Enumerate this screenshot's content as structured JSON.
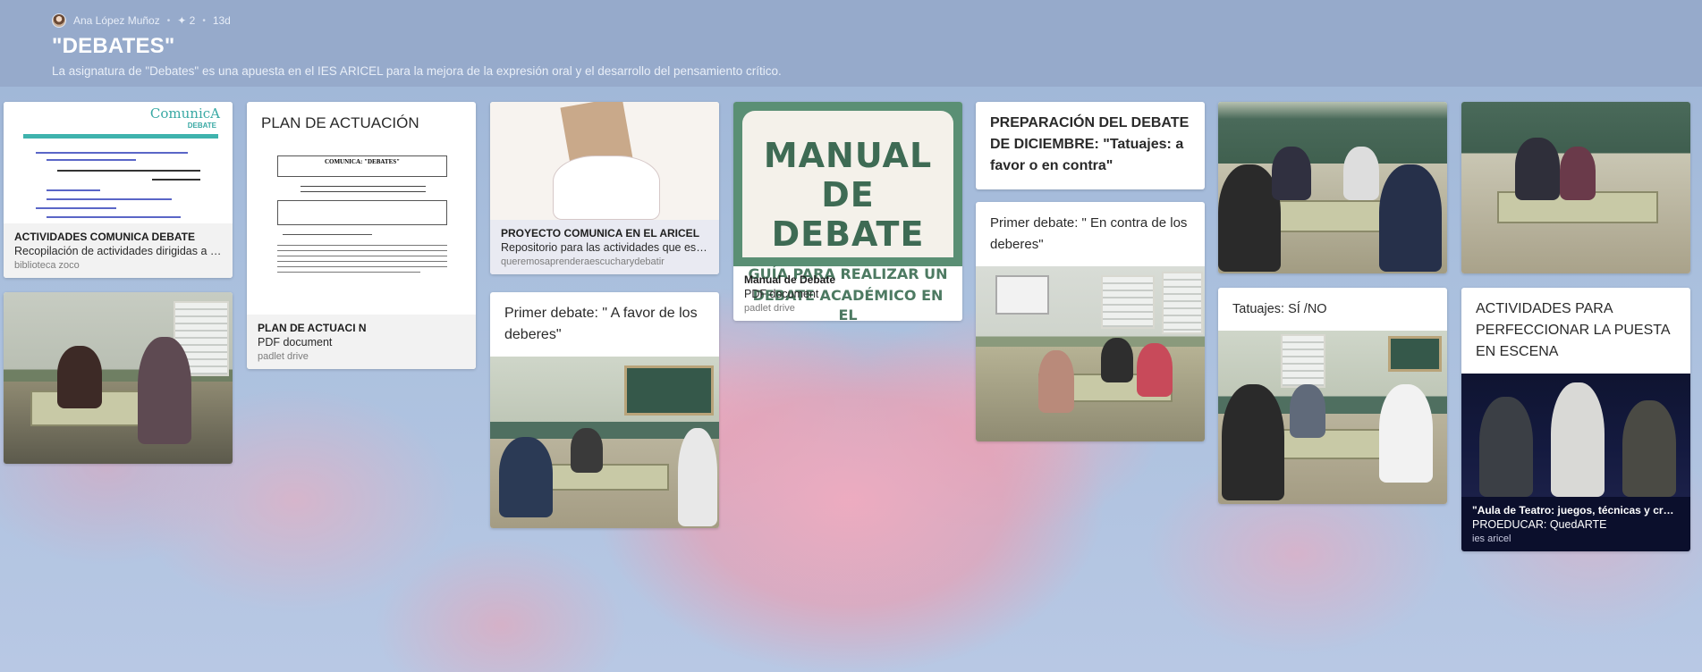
{
  "header": {
    "author": "Ana López Muñoz",
    "plus_count": "✦ 2",
    "dot": "•",
    "age": "13d",
    "title": "\"DEBATES\"",
    "description": "La asignatura de \"Debates\" es una apuesta en el IES ARICEL para la mejora de la expresión oral y el desarrollo del pensamiento crítico."
  },
  "posts": {
    "p1": {
      "preview_brand": "ComunicA",
      "preview_sub": "DEBATE",
      "att_title": "ACTIVIDADES COMUNICA DEBATE",
      "att_sub": "Recopilación de actividades dirigidas a la...",
      "att_src": "biblioteca zoco"
    },
    "p2": {
      "title": "PLAN DE ACTUACIÓN",
      "doc_head": "COMUNICA: \"DEBATES\"",
      "att_title": "PLAN DE ACTUACI N",
      "att_sub": "PDF document",
      "att_src": "padlet drive"
    },
    "p3": {
      "att_title": "PROYECTO COMUNICA EN EL ARICEL",
      "att_sub": "Repositorio para las actividades que esta...",
      "att_src": "queremosaprenderaescucharydebatir"
    },
    "p4": {
      "cover_big_1": "MANUAL",
      "cover_big_2": "DE DEBATE",
      "cover_small_1": "GUÍA PARA REALIZAR UN",
      "cover_small_2": "DEBATE ACADÉMICO EN EL",
      "att_title": "Manual de Debate",
      "att_sub": "PDF document",
      "att_src": "padlet drive"
    },
    "p5": {
      "title": "PREPARACIÓN DEL DEBATE DE DICIEMBRE: \"Tatuajes: a favor o en contra\""
    },
    "p6": {
      "title": "Primer debate: \" En contra de los deberes\""
    },
    "p7": {
      "title": "Primer debate: \" A favor de los deberes\""
    },
    "p8": {
      "title": "Tatuajes: SÍ /NO"
    },
    "p9": {
      "title": "ACTIVIDADES PARA PERFECCIONAR LA PUESTA EN ESCENA",
      "att_title": "\"Aula de Teatro: juegos, técnicas y creac...",
      "att_sub": "PROEDUCAR: QuedARTE",
      "att_src": "ies aricel"
    }
  }
}
